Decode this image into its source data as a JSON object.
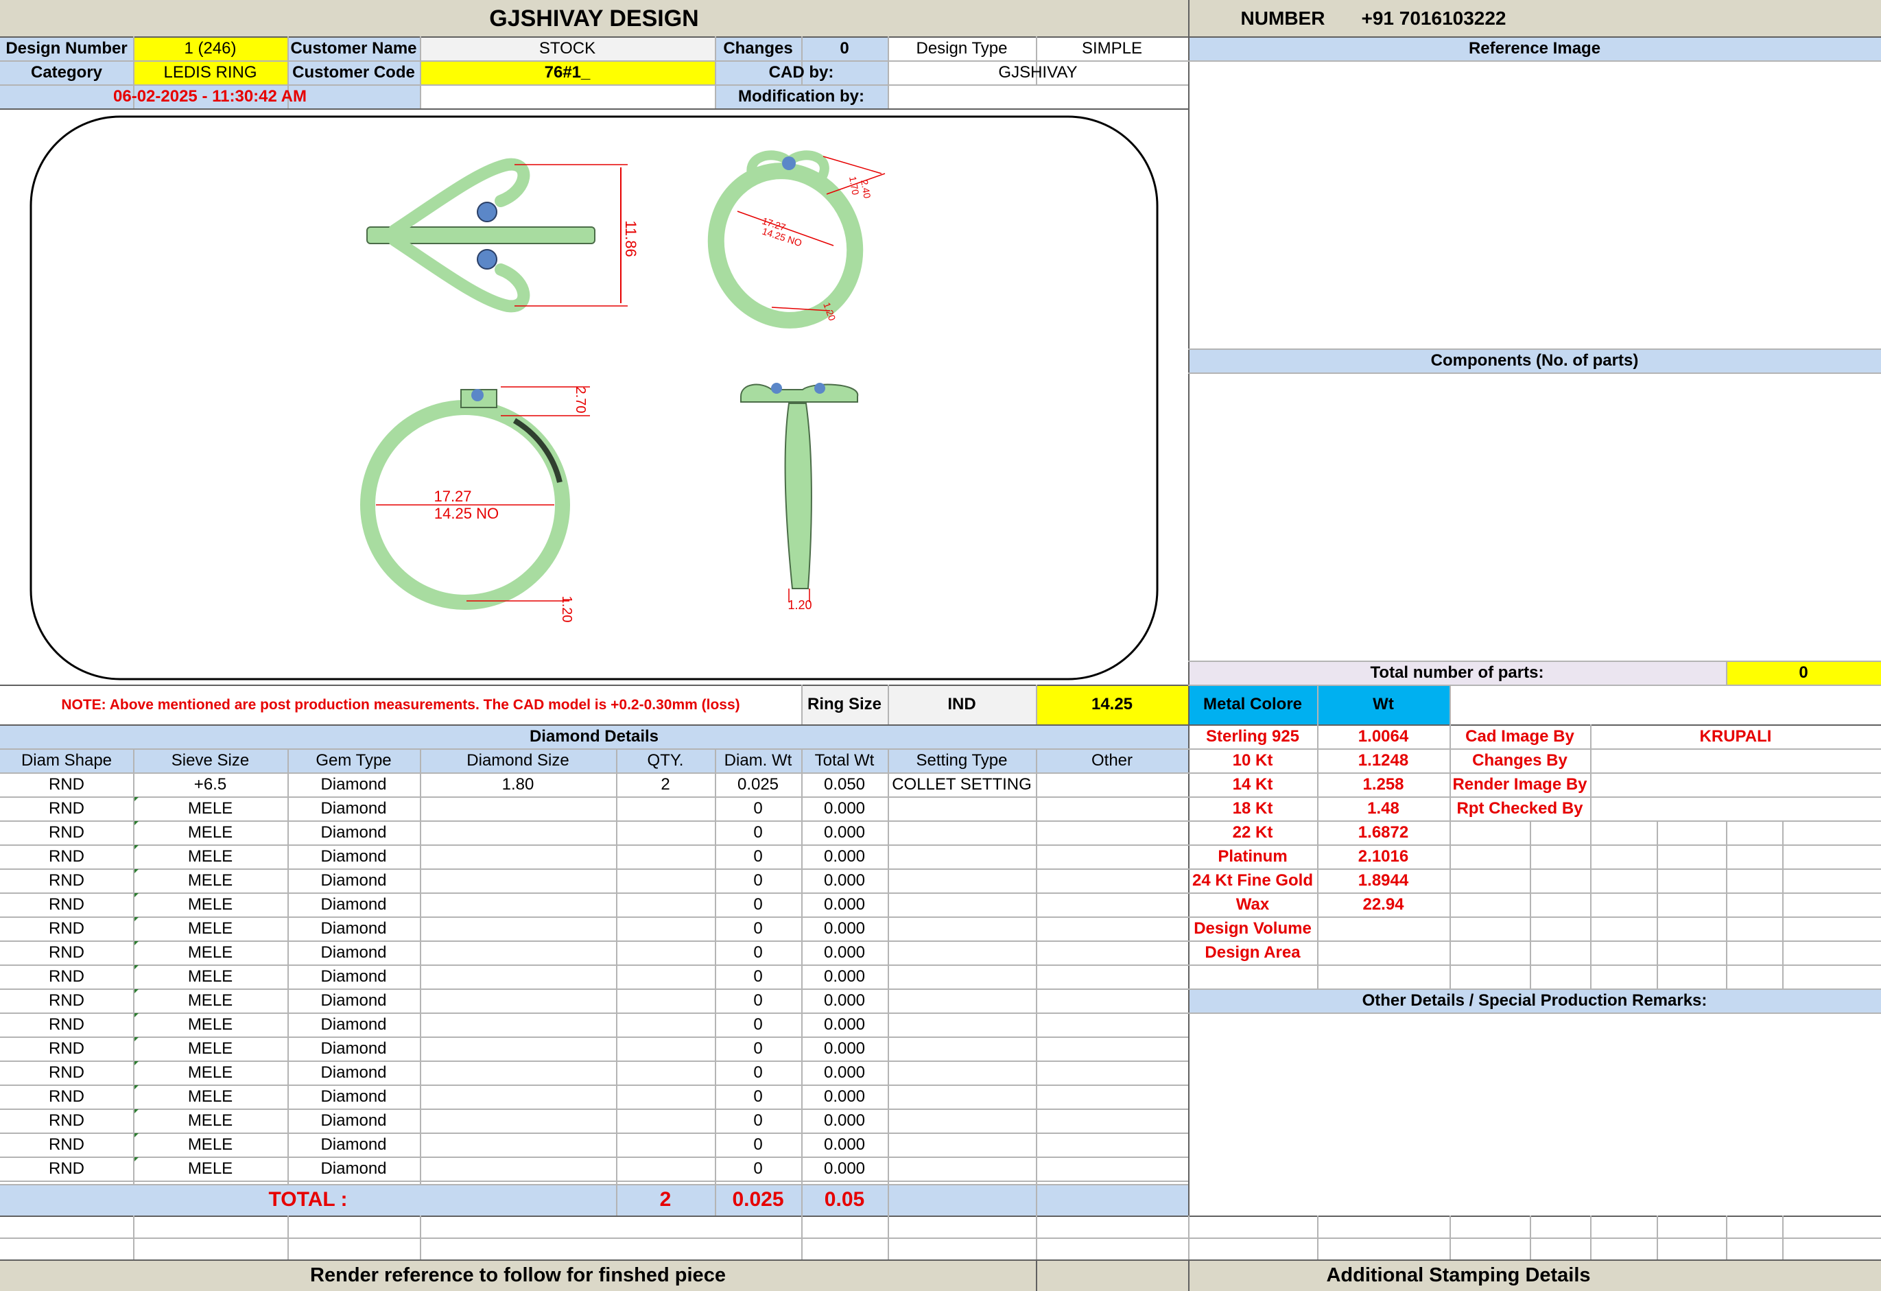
{
  "title": "GJSHIVAY DESIGN",
  "contact": {
    "label": "NUMBER",
    "value": "+91 7016103222"
  },
  "info": {
    "design_number_label": "Design Number",
    "design_number": "1 (246)",
    "customer_name_label": "Customer Name",
    "customer_name": "STOCK",
    "changes_label": "Changes",
    "changes": "0",
    "design_type_label": "Design Type",
    "design_type": "SIMPLE",
    "category_label": "Category",
    "category": "LEDIS RING",
    "customer_code_label": "Customer Code",
    "customer_code": "76#1_",
    "cad_by_label": "CAD by:",
    "cad_by": "GJSHIVAY",
    "date": "06-02-2025 - 11:30:42 AM",
    "modification_label": "Modification by:",
    "modification": ""
  },
  "reference_image_label": "Reference Image",
  "components_label": "Components (No. of parts)",
  "total_parts_label": "Total number of parts:",
  "total_parts": "0",
  "drawing": {
    "top_height": "11.86",
    "persp_width": "1.70",
    "persp_height": "2.40",
    "persp_dia": "17.27",
    "persp_size": "14.25 NO",
    "persp_shank": "1.20",
    "front_dia": "17.27",
    "front_size": "14.25 NO",
    "front_head": "2.70",
    "front_shank": "1.20",
    "side_width": "1.20",
    "ring_color": "#a8dca0",
    "stone_color": "#5b87c8"
  },
  "note": "NOTE: Above mentioned are post production measurements. The CAD model is +0.2-0.30mm (loss)",
  "ring_size": {
    "label": "Ring Size",
    "standard": "IND",
    "value": "14.25"
  },
  "metal": {
    "header_label": "Metal Colore",
    "wt_label": "Wt",
    "rows": [
      {
        "name": "Sterling 925",
        "wt": "1.0064"
      },
      {
        "name": "10 Kt",
        "wt": "1.1248"
      },
      {
        "name": "14 Kt",
        "wt": "1.258"
      },
      {
        "name": "18 Kt",
        "wt": "1.48"
      },
      {
        "name": "22 Kt",
        "wt": "1.6872"
      },
      {
        "name": "Platinum",
        "wt": "2.1016"
      },
      {
        "name": "24 Kt Fine Gold",
        "wt": "1.8944"
      },
      {
        "name": "Wax",
        "wt": "22.94"
      },
      {
        "name": "Design Volume",
        "wt": ""
      },
      {
        "name": "Design Area",
        "wt": ""
      }
    ]
  },
  "people": [
    {
      "label": "Cad Image By",
      "value": "KRUPALI"
    },
    {
      "label": "Changes By",
      "value": ""
    },
    {
      "label": "Render Image By",
      "value": ""
    },
    {
      "label": "Rpt Checked By",
      "value": ""
    }
  ],
  "diamond": {
    "title": "Diamond Details",
    "columns": [
      "Diam Shape",
      "Sieve Size",
      "Gem Type",
      "Diamond Size",
      "QTY.",
      "Diam. Wt",
      "Total Wt",
      "Setting Type",
      "Other"
    ],
    "rows": [
      [
        "RND",
        "+6.5",
        "Diamond",
        "1.80",
        "2",
        "0.025",
        "0.050",
        "COLLET SETTING",
        ""
      ],
      [
        "RND",
        "MELE",
        "Diamond",
        "",
        "",
        "0",
        "0.000",
        "",
        ""
      ],
      [
        "RND",
        "MELE",
        "Diamond",
        "",
        "",
        "0",
        "0.000",
        "",
        ""
      ],
      [
        "RND",
        "MELE",
        "Diamond",
        "",
        "",
        "0",
        "0.000",
        "",
        ""
      ],
      [
        "RND",
        "MELE",
        "Diamond",
        "",
        "",
        "0",
        "0.000",
        "",
        ""
      ],
      [
        "RND",
        "MELE",
        "Diamond",
        "",
        "",
        "0",
        "0.000",
        "",
        ""
      ],
      [
        "RND",
        "MELE",
        "Diamond",
        "",
        "",
        "0",
        "0.000",
        "",
        ""
      ],
      [
        "RND",
        "MELE",
        "Diamond",
        "",
        "",
        "0",
        "0.000",
        "",
        ""
      ],
      [
        "RND",
        "MELE",
        "Diamond",
        "",
        "",
        "0",
        "0.000",
        "",
        ""
      ],
      [
        "RND",
        "MELE",
        "Diamond",
        "",
        "",
        "0",
        "0.000",
        "",
        ""
      ],
      [
        "RND",
        "MELE",
        "Diamond",
        "",
        "",
        "0",
        "0.000",
        "",
        ""
      ],
      [
        "RND",
        "MELE",
        "Diamond",
        "",
        "",
        "0",
        "0.000",
        "",
        ""
      ],
      [
        "RND",
        "MELE",
        "Diamond",
        "",
        "",
        "0",
        "0.000",
        "",
        ""
      ],
      [
        "RND",
        "MELE",
        "Diamond",
        "",
        "",
        "0",
        "0.000",
        "",
        ""
      ],
      [
        "RND",
        "MELE",
        "Diamond",
        "",
        "",
        "0",
        "0.000",
        "",
        ""
      ],
      [
        "RND",
        "MELE",
        "Diamond",
        "",
        "",
        "0",
        "0.000",
        "",
        ""
      ],
      [
        "RND",
        "MELE",
        "Diamond",
        "",
        "",
        "0",
        "0.000",
        "",
        ""
      ]
    ],
    "total_label": "TOTAL :",
    "total_qty": "2",
    "total_diam_wt": "0.025",
    "total_wt": "0.05"
  },
  "other_details_label": "Other Details / Special Production Remarks:",
  "footer": {
    "render_note": "Render reference to follow for finshed piece",
    "stamping": "Additional Stamping Details"
  }
}
